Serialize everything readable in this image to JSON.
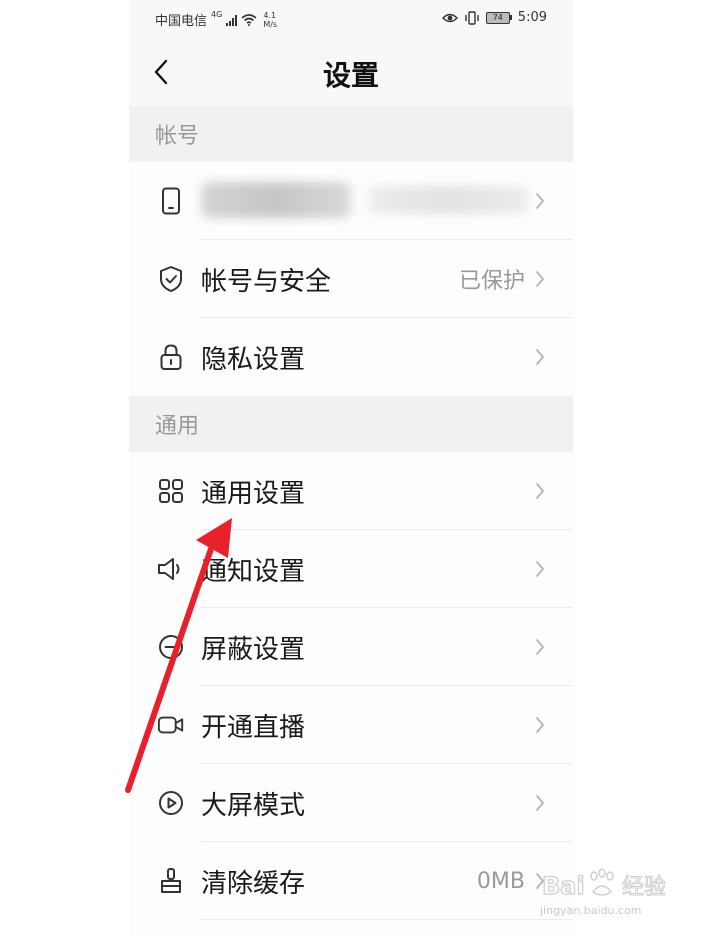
{
  "status_bar": {
    "carrier": "中国电信",
    "network_tag": "4G",
    "speed_value": "4.1",
    "speed_unit": "M/s",
    "battery": "74",
    "time": "5:09"
  },
  "header": {
    "back_icon": "chevron-left-icon",
    "title": "设置"
  },
  "sections": [
    {
      "title": "帐号",
      "rows": [
        {
          "icon": "phone-icon",
          "label": "",
          "value": "",
          "redacted": true
        },
        {
          "icon": "shield-icon",
          "label": "帐号与安全",
          "value": "已保护"
        },
        {
          "icon": "lock-icon",
          "label": "隐私设置",
          "value": ""
        }
      ]
    },
    {
      "title": "通用",
      "rows": [
        {
          "icon": "grid-icon",
          "label": "通用设置",
          "value": ""
        },
        {
          "icon": "speaker-icon",
          "label": "通知设置",
          "value": ""
        },
        {
          "icon": "block-icon",
          "label": "屏蔽设置",
          "value": ""
        },
        {
          "icon": "video-camera-icon",
          "label": "开通直播",
          "value": ""
        },
        {
          "icon": "play-icon",
          "label": "大屏模式",
          "value": ""
        },
        {
          "icon": "broom-icon",
          "label": "清除缓存",
          "value": "0MB"
        }
      ]
    }
  ],
  "watermark": {
    "brand": "Baidu经验",
    "site": "jingyan.baidu.com"
  },
  "colors": {
    "arrow": "#e8202a",
    "background": "#f5f5f5",
    "row_background": "#fdfdfd",
    "muted_text": "#999999"
  }
}
